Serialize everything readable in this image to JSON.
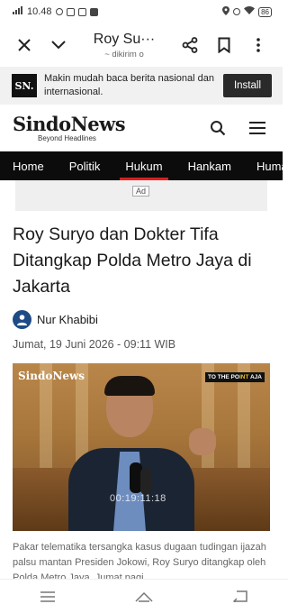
{
  "status_bar": {
    "time": "10.48",
    "battery": "86"
  },
  "browser_bar": {
    "title": "Roy Su···",
    "subtitle": "~ dikirim o"
  },
  "install_banner": {
    "logo_text": "SN.",
    "message": "Makin mudah baca berita nasional dan internasional.",
    "install_label": "Install"
  },
  "site": {
    "brand": "SindoNews",
    "tagline": "Beyond Headlines"
  },
  "nav": {
    "items": [
      "Home",
      "Politik",
      "Hukum",
      "Hankam",
      "Humaniora"
    ],
    "active": "Hukum"
  },
  "ad": {
    "label": "Ad"
  },
  "article": {
    "headline": "Roy Suryo dan Dokter Tifa Ditangkap Polda Metro Jaya di Jakarta",
    "author": "Nur Khabibi",
    "date": "Jumat, 19 Juni 2026 - 09:11 WIB",
    "photo": {
      "logo": "SindoNews",
      "badge_prefix": "TO THE PO",
      "badge_highlight": "INT",
      "badge_suffix": " AJA",
      "timecode": "00:19:11:18"
    },
    "caption": "Pakar telematika tersangka kasus dugaan tudingan ijazah palsu mantan Presiden Jokowi, Roy Suryo ditangkap oleh Polda Metro Jaya, Jumat pagi"
  },
  "colors": {
    "nav_bg": "#0c0c0c",
    "nav_active_underline": "#d9201e",
    "author_avatar": "#1e4b86",
    "banner_bg": "#f1f1f1"
  },
  "icons": {
    "close": "close-icon",
    "chevron": "chevron-down-icon",
    "share": "share-icon",
    "bookmark": "bookmark-icon",
    "more": "more-vertical-icon",
    "search": "search-icon",
    "menu": "hamburger-menu-icon",
    "author": "user-icon",
    "home": "home-icon",
    "recents": "recents-icon",
    "back": "back-icon"
  }
}
